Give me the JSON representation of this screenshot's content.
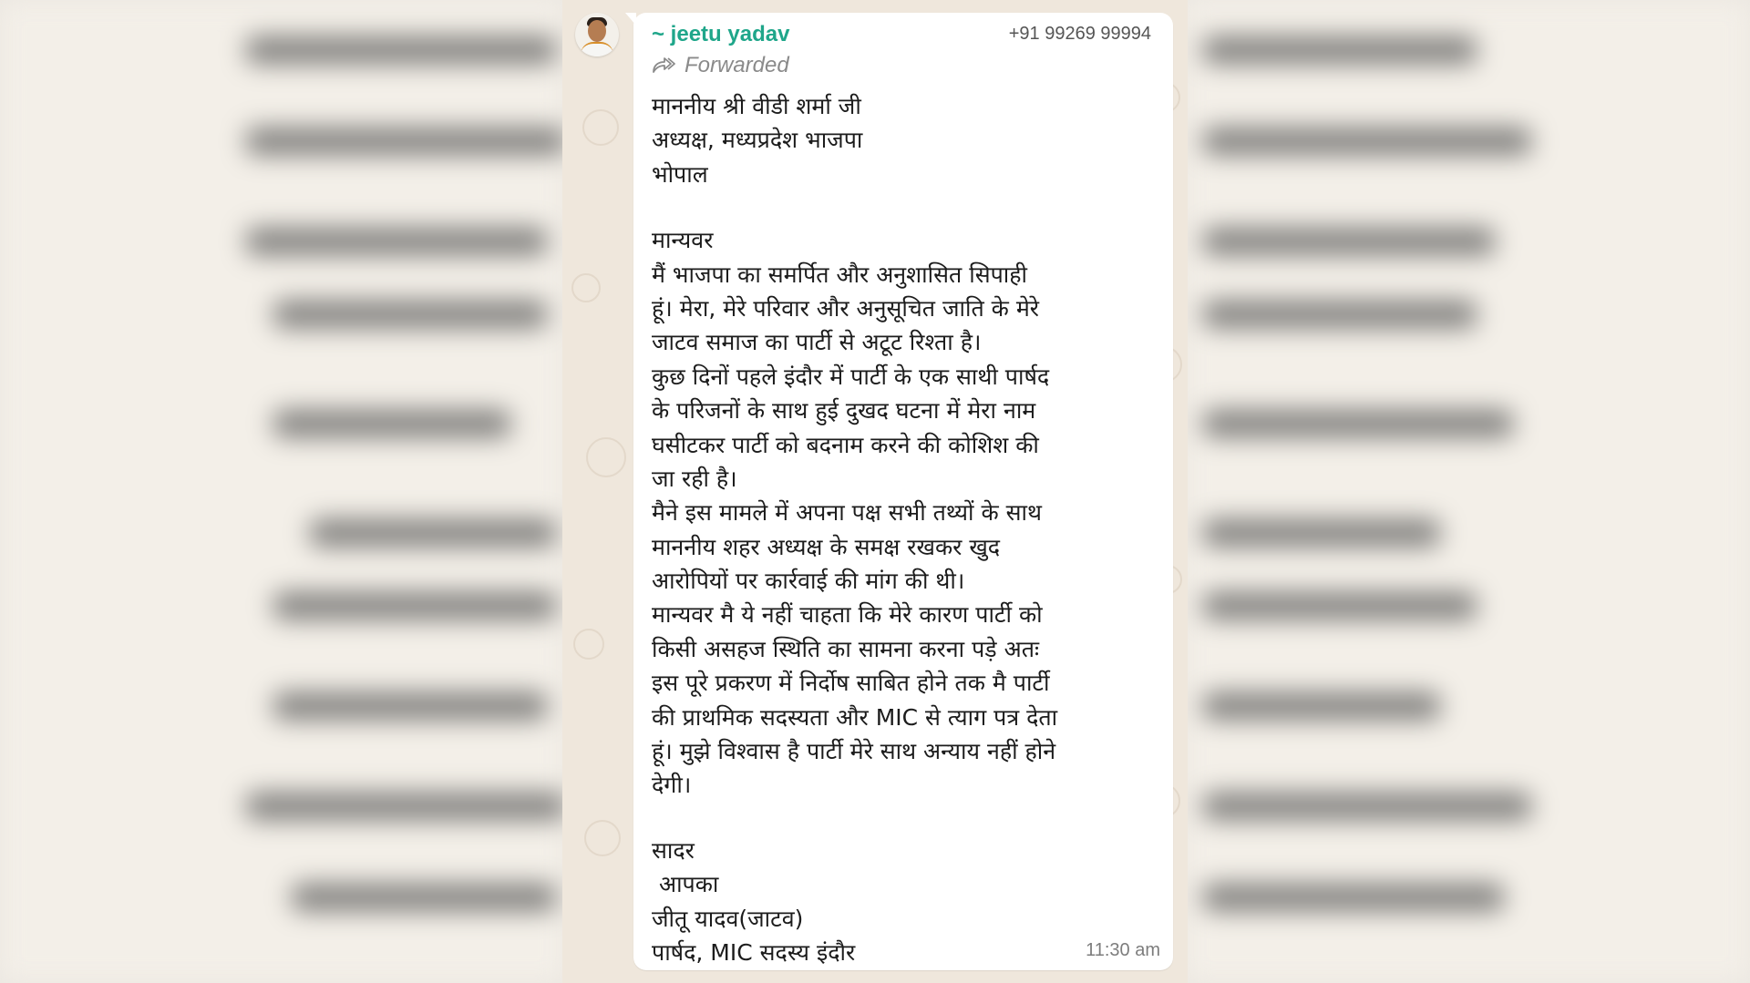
{
  "message": {
    "sender_name": "~ jeetu yadav",
    "sender_phone": "+91 99269 99994",
    "forwarded_label": "Forwarded",
    "time": "11:30 am",
    "address_lines": [
      "माननीय श्री वीडी शर्मा जी",
      "अध्यक्ष, मध्यप्रदेश भाजपा",
      "भोपाल"
    ],
    "salutation": "मान्यवर",
    "body_lines": [
      "मैं भाजपा का समर्पित और अनुशासित सिपाही",
      "हूं। मेरा, मेरे परिवार और अनुसूचित जाति के मेरे",
      "जाटव समाज का पार्टी से अटूट रिश्ता है।",
      "कुछ दिनों पहले इंदौर में पार्टी के एक साथी पार्षद",
      "के परिजनों के साथ हुई दुखद घटना में मेरा नाम",
      "घसीटकर पार्टी को बदनाम करने की कोशिश की",
      "जा रही है।",
      "मैने इस मामले में अपना पक्ष सभी तथ्यों के साथ",
      "माननीय शहर अध्यक्ष के समक्ष रखकर खुद",
      "आरोपियों पर कार्रवाई की मांग की थी।",
      "मान्यवर मै ये नहीं चाहता कि मेरे कारण पार्टी को",
      "किसी असहज स्थिति का सामना करना पड़े अतः",
      "इस पूरे प्रकरण में निर्दोष साबित होने तक मै पार्टी",
      "की प्राथमिक सदस्यता और MIC से त्याग पत्र देता",
      "हूं। मुझे विश्वास है पार्टी मेरे साथ अन्याय नहीं होने",
      "देगी।"
    ],
    "closing_lines": [
      "सादर",
      " आपका",
      "जीतू यादव(जाटव)",
      "पार्षद, MIC सदस्य इंदौर"
    ]
  }
}
